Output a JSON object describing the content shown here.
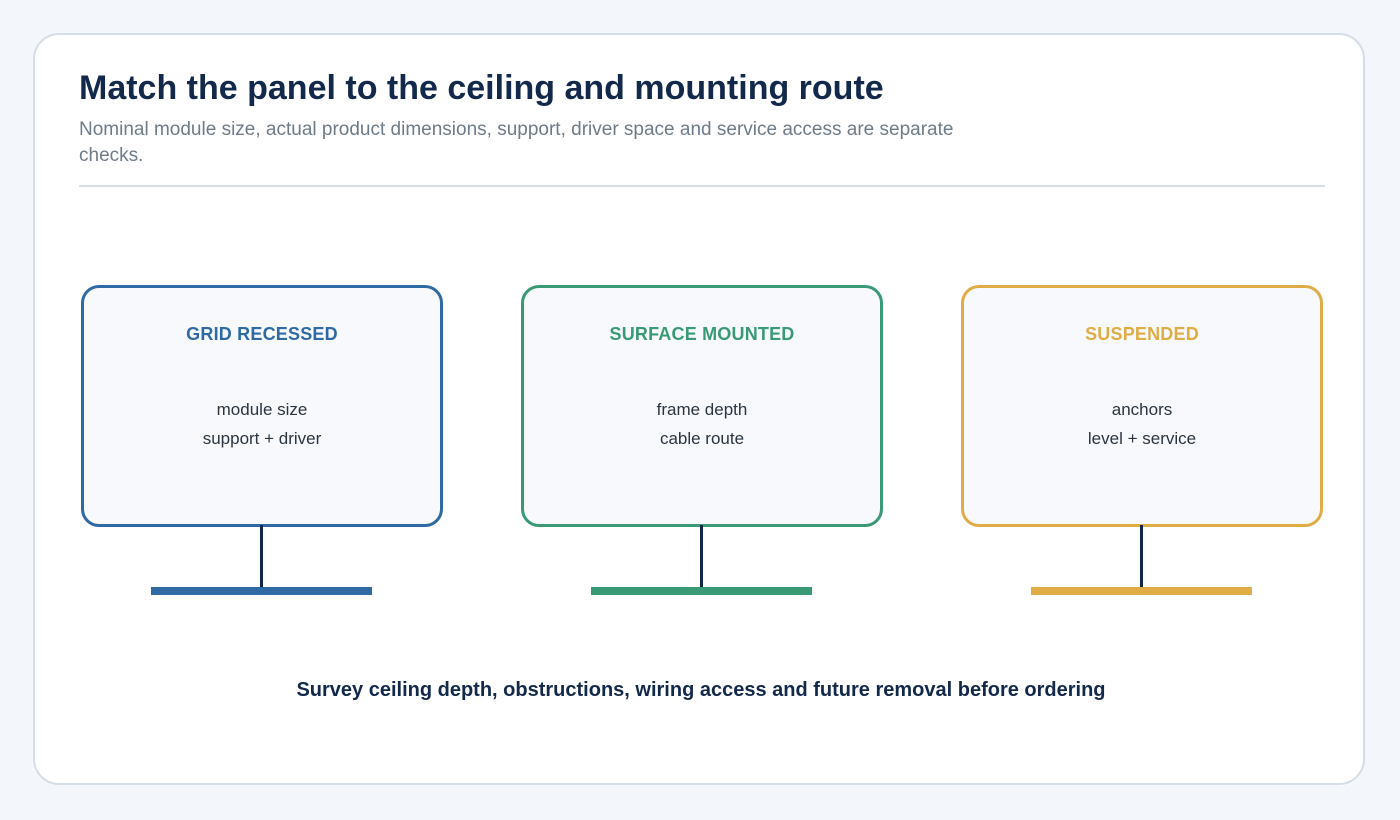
{
  "header": {
    "title": "Match the panel to the ceiling and mounting route",
    "subtitle": "Nominal module size, actual product dimensions, support, driver space and service access are separate checks."
  },
  "mounts": [
    {
      "title": "GRID RECESSED",
      "color": "#2f6aa5",
      "lines": [
        "module size",
        "support + driver"
      ]
    },
    {
      "title": "SURFACE MOUNTED",
      "color": "#3a9a75",
      "lines": [
        "frame depth",
        "cable route"
      ]
    },
    {
      "title": "SUSPENDED",
      "color": "#e0ac45",
      "lines": [
        "anchors",
        "level + service"
      ]
    }
  ],
  "footer": {
    "note": "Survey ceiling depth, obstructions, wiring access and future removal before ordering"
  }
}
